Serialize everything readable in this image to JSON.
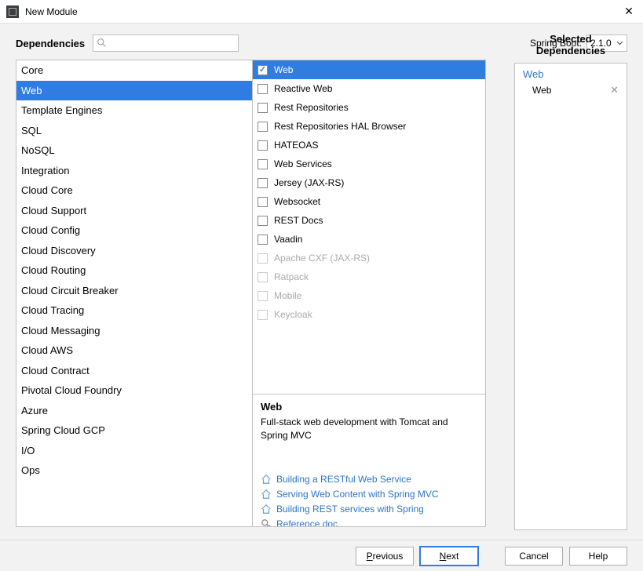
{
  "window": {
    "title": "New Module"
  },
  "header": {
    "dependencies_label": "Dependencies",
    "search_placeholder": "",
    "spring_boot_label": "Spring Boot:",
    "spring_boot_version": "2.1.0"
  },
  "categories": [
    "Core",
    "Web",
    "Template Engines",
    "SQL",
    "NoSQL",
    "Integration",
    "Cloud Core",
    "Cloud Support",
    "Cloud Config",
    "Cloud Discovery",
    "Cloud Routing",
    "Cloud Circuit Breaker",
    "Cloud Tracing",
    "Cloud Messaging",
    "Cloud AWS",
    "Cloud Contract",
    "Pivotal Cloud Foundry",
    "Azure",
    "Spring Cloud GCP",
    "I/O",
    "Ops"
  ],
  "category_selected_index": 1,
  "dependencies": [
    {
      "label": "Web",
      "checked": true,
      "enabled": true,
      "selected": true
    },
    {
      "label": "Reactive Web",
      "checked": false,
      "enabled": true,
      "selected": false
    },
    {
      "label": "Rest Repositories",
      "checked": false,
      "enabled": true,
      "selected": false
    },
    {
      "label": "Rest Repositories HAL Browser",
      "checked": false,
      "enabled": true,
      "selected": false
    },
    {
      "label": "HATEOAS",
      "checked": false,
      "enabled": true,
      "selected": false
    },
    {
      "label": "Web Services",
      "checked": false,
      "enabled": true,
      "selected": false
    },
    {
      "label": "Jersey (JAX-RS)",
      "checked": false,
      "enabled": true,
      "selected": false
    },
    {
      "label": "Websocket",
      "checked": false,
      "enabled": true,
      "selected": false
    },
    {
      "label": "REST Docs",
      "checked": false,
      "enabled": true,
      "selected": false
    },
    {
      "label": "Vaadin",
      "checked": false,
      "enabled": true,
      "selected": false
    },
    {
      "label": "Apache CXF (JAX-RS)",
      "checked": false,
      "enabled": false,
      "selected": false
    },
    {
      "label": "Ratpack",
      "checked": false,
      "enabled": false,
      "selected": false
    },
    {
      "label": "Mobile",
      "checked": false,
      "enabled": false,
      "selected": false
    },
    {
      "label": "Keycloak",
      "checked": false,
      "enabled": false,
      "selected": false
    }
  ],
  "description": {
    "title": "Web",
    "text": "Full-stack web development with Tomcat and Spring MVC",
    "links": [
      {
        "type": "guide",
        "label": "Building a RESTful Web Service"
      },
      {
        "type": "guide",
        "label": "Serving Web Content with Spring MVC"
      },
      {
        "type": "guide",
        "label": "Building REST services with Spring"
      },
      {
        "type": "ref",
        "label": "Reference doc"
      }
    ]
  },
  "selected_panel": {
    "title": "Selected Dependencies",
    "groups": [
      {
        "name": "Web",
        "items": [
          "Web"
        ]
      }
    ]
  },
  "buttons": {
    "previous": "Previous",
    "next": "Next",
    "cancel": "Cancel",
    "help": "Help"
  }
}
